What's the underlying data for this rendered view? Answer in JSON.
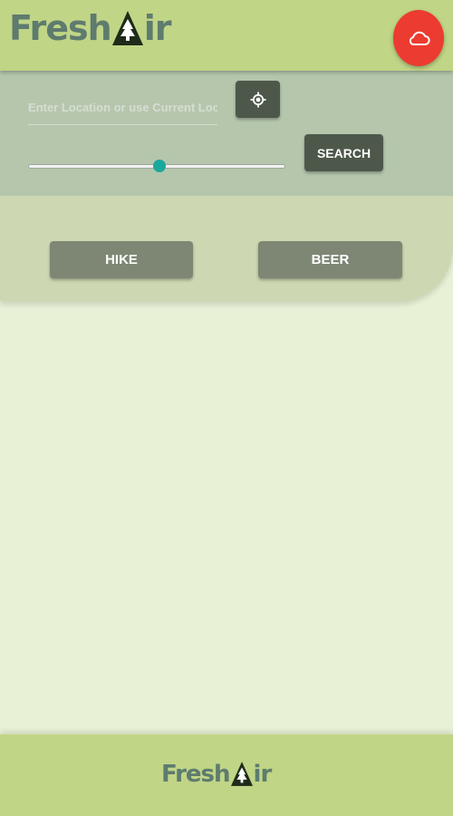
{
  "header": {
    "logo": {
      "part1": "Fresh",
      "part2": "ir"
    },
    "cloud_button_icon": "cloud-icon",
    "cloud_button_color": "#ec3b30"
  },
  "search": {
    "location_placeholder": "Enter Location or use Current Location",
    "locate_icon": "gps-locate-icon",
    "search_label": "SEARCH",
    "radius_fraction": 0.51
  },
  "categories": [
    {
      "label": "HIKE"
    },
    {
      "label": "BEER"
    }
  ],
  "footer": {
    "logo": {
      "part1": "Fresh",
      "part2": "ir"
    }
  },
  "colors": {
    "header_bg": "#c0d586",
    "panel_bg": "#b5c6ad",
    "dark_button": "#4d584b",
    "category_button": "#7d8773",
    "slider_accent": "#1ba89a",
    "logo_text": "#5e7b6e"
  }
}
